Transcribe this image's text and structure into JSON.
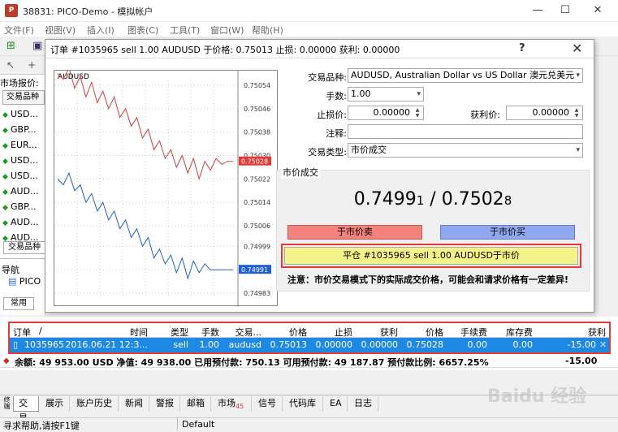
{
  "window": {
    "title": "38831: PICO-Demo - 模拟帐户",
    "buttons": [
      "—",
      "☐",
      "✕"
    ]
  },
  "menu": [
    {
      "label": "文件(F)"
    },
    {
      "label": "视图(V)"
    },
    {
      "label": "插入(I)"
    },
    {
      "label": "图表(C)"
    },
    {
      "label": "工具(T)"
    },
    {
      "label": "窗口(W)"
    },
    {
      "label": "帮助(H)"
    }
  ],
  "market_watch": {
    "title": "市场报价:",
    "column": "交易品种",
    "symbols": [
      {
        "label": "USD...",
        "dir": "up"
      },
      {
        "label": "GBP...",
        "dir": "up"
      },
      {
        "label": "EUR...",
        "dir": "up"
      },
      {
        "label": "USD...",
        "dir": "up"
      },
      {
        "label": "USD...",
        "dir": "up"
      },
      {
        "label": "AUD...",
        "dir": "up"
      },
      {
        "label": "GBP...",
        "dir": "up"
      },
      {
        "label": "AUD...",
        "dir": "up"
      },
      {
        "label": "AUD...",
        "dir": "up"
      }
    ],
    "tab_symbols": "交易品种",
    "nav_title": "导航",
    "nav_item": "PICO",
    "tab_common": "常用"
  },
  "dialog": {
    "title": "订单 #1035965 sell 1.00 AUDUSD 于价格: 0.75013 止损: 0.00000 获利: 0.00000",
    "help": "?",
    "close": "✕",
    "chart_symbol": "AUDUSD",
    "form": {
      "symbol_label": "交易品种:",
      "symbol_value": "AUDUSD, Australian Dollar vs US Dollar 澳元兑美元",
      "lots_label": "手数:",
      "lots_value": "1.00",
      "sl_label": "止损价:",
      "sl_value": "0.00000",
      "tp_label": "获利价:",
      "tp_value": "0.00000",
      "comment_label": "注释:",
      "comment_value": "",
      "type_label": "交易类型:",
      "type_value": "市价成交"
    },
    "market_section": "市价成交",
    "bid_main": "0.7499",
    "bid_small": "1",
    "separator": " / ",
    "ask_main": "0.7502",
    "ask_small": "8",
    "sell_btn": "于市价卖",
    "buy_btn": "于市价买",
    "close_btn": "平仓 #1035965 sell 1.00 AUDUSD于市价",
    "note": "注意：市价交易模式下的实际成交价格，可能会和请求价格有一定差异!"
  },
  "chart_data": {
    "type": "line",
    "ylim": [
      0.74983,
      0.75054
    ],
    "ytick_labels": [
      "0.75054",
      "0.75046",
      "0.75038",
      "0.75030",
      "0.75022",
      "0.75014",
      "0.75006",
      "0.74999",
      "0.74991",
      "0.74983"
    ],
    "ask_label": "0.75028",
    "bid_label": "0.74991",
    "series": [
      {
        "color": "#e53935",
        "values": [
          0.75058,
          0.75056,
          0.7506,
          0.75053,
          0.75057,
          0.7505,
          0.75055,
          0.75048,
          0.75052,
          0.75046,
          0.7505,
          0.75043,
          0.75046,
          0.7504,
          0.75043,
          0.75036,
          0.75039,
          0.75032,
          0.75035,
          0.75029,
          0.75032,
          0.75026,
          0.7503,
          0.75024,
          0.75029,
          0.75022,
          0.75028,
          0.75025,
          0.75029,
          0.75027,
          0.75028,
          0.75028
        ]
      },
      {
        "color": "#1e5fd6",
        "values": [
          0.75022,
          0.7502,
          0.75024,
          0.75018,
          0.7502,
          0.75014,
          0.75017,
          0.75011,
          0.75014,
          0.75008,
          0.75011,
          0.75005,
          0.75008,
          0.75002,
          0.75005,
          0.74999,
          0.75002,
          0.74995,
          0.74998,
          0.74993,
          0.74996,
          0.7499,
          0.74995,
          0.74988,
          0.74994,
          0.7499,
          0.74993,
          0.74991,
          0.74991,
          0.74991,
          0.74991,
          0.74991
        ]
      }
    ]
  },
  "terminal": {
    "columns": [
      "订单",
      "/",
      "时间",
      "类型",
      "手数",
      "交易...",
      "价格",
      "止损",
      "获利",
      "价格",
      "手续费",
      "库存费",
      "获利"
    ],
    "row": [
      "1035965",
      "2016.06.21 12:3...",
      "sell",
      "1.00",
      "audusd",
      "0.75013",
      "0.00000",
      "0.00000",
      "0.75028",
      "0.00",
      "0.00",
      "-15.00"
    ],
    "row_close": "✕",
    "balance": "余额: 49 953.00 USD  净值: 49 938.00  已用预付款: 750.13  可用预付款: 49 187.87  预付款比例: 6657.25%",
    "balance_total": "-15.00"
  },
  "bottom_tabs": [
    {
      "label": "交易"
    },
    {
      "label": "展示"
    },
    {
      "label": "账户历史"
    },
    {
      "label": "新闻"
    },
    {
      "label": "警报"
    },
    {
      "label": "邮箱"
    },
    {
      "label": "市场",
      "badge": "45"
    },
    {
      "label": "信号"
    },
    {
      "label": "代码库"
    },
    {
      "label": "EA"
    },
    {
      "label": "日志"
    }
  ],
  "side_label": "终端",
  "status": {
    "help": "寻求帮助,请按F1键",
    "profile": "Default"
  },
  "watermark": "Baidu 经验"
}
